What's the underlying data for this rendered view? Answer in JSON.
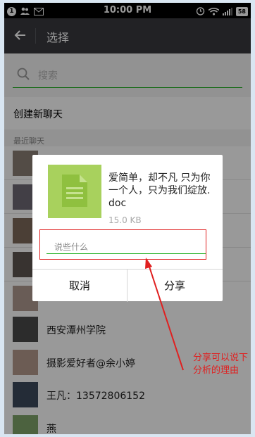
{
  "status_bar": {
    "notification_count": "1",
    "time": "10:00 PM",
    "battery": "58"
  },
  "title_bar": {
    "back_icon": "arrow-left-icon",
    "title": "选择"
  },
  "search": {
    "placeholder": "搜索",
    "icon": "search-icon"
  },
  "new_chat": {
    "label": "创建新聊天"
  },
  "recent_section": {
    "label": "最近聊天"
  },
  "recent_chats": [
    {
      "name": ""
    },
    {
      "name": ""
    },
    {
      "name": ""
    },
    {
      "name": ""
    },
    {
      "name": ""
    },
    {
      "name": "西安潭州学院"
    },
    {
      "name": "摄影爱好者@余小婷"
    },
    {
      "name": "王凡：13572806152"
    },
    {
      "name": "燕"
    }
  ],
  "share_dialog": {
    "file_icon": "document-icon",
    "file_name": "爱简单，却不凡 只为你一个人，只为我们绽放.doc",
    "file_size": "15.0 KB",
    "message_placeholder": "说些什么",
    "cancel_label": "取消",
    "share_label": "分享"
  },
  "annotation": {
    "text": "分享可以说下分析的理由",
    "color": "#e02020"
  },
  "colors": {
    "titlebar": "#393a3f",
    "accent_green": "#1aad19",
    "file_icon_bg": "#a8d15d"
  }
}
